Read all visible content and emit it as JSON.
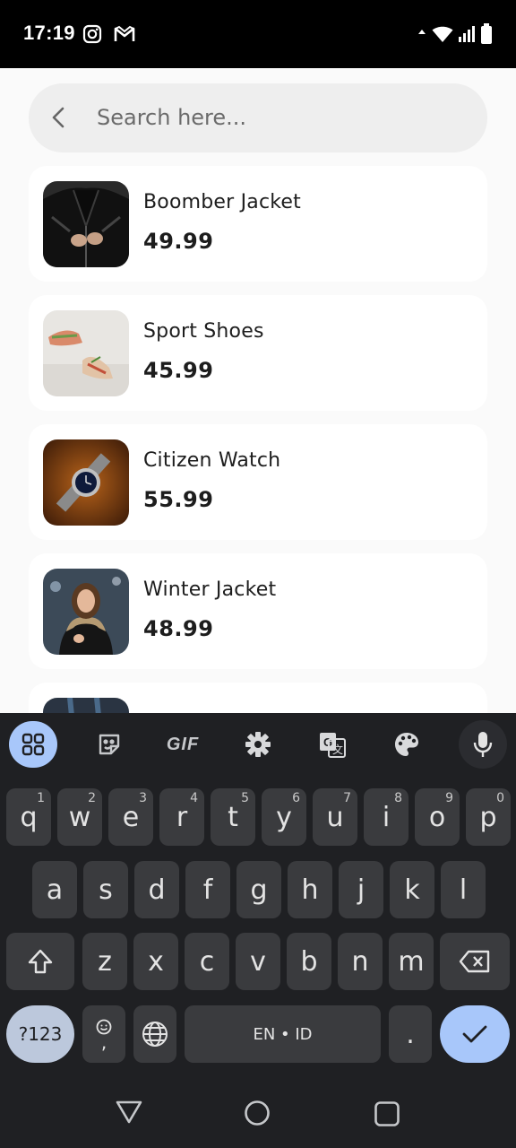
{
  "status": {
    "time": "17:19",
    "icons": [
      "instagram-icon",
      "gmail-icon",
      "data-arrows-icon",
      "wifi-icon",
      "signal-icon",
      "battery-icon"
    ]
  },
  "search": {
    "placeholder": "Search here...",
    "value": ""
  },
  "products": [
    {
      "name": "Boomber Jacket",
      "price": "49.99"
    },
    {
      "name": "Sport Shoes",
      "price": "45.99"
    },
    {
      "name": "Citizen Watch",
      "price": "55.99"
    },
    {
      "name": "Winter Jacket",
      "price": "48.99"
    }
  ],
  "keyboard": {
    "toolbar": {
      "gif_label": "GIF",
      "icons": [
        "apps-grid-icon",
        "sticker-icon",
        "gif-icon",
        "settings-gear-icon",
        "translate-icon",
        "palette-icon",
        "microphone-icon"
      ]
    },
    "row1": [
      {
        "key": "q",
        "hint": "1"
      },
      {
        "key": "w",
        "hint": "2"
      },
      {
        "key": "e",
        "hint": "3"
      },
      {
        "key": "r",
        "hint": "4"
      },
      {
        "key": "t",
        "hint": "5"
      },
      {
        "key": "y",
        "hint": "6"
      },
      {
        "key": "u",
        "hint": "7"
      },
      {
        "key": "i",
        "hint": "8"
      },
      {
        "key": "o",
        "hint": "9"
      },
      {
        "key": "p",
        "hint": "0"
      }
    ],
    "row2": [
      "a",
      "s",
      "d",
      "f",
      "g",
      "h",
      "j",
      "k",
      "l"
    ],
    "row3": [
      "z",
      "x",
      "c",
      "v",
      "b",
      "n",
      "m"
    ],
    "symbols_label": "?123",
    "comma_label": ",",
    "space_label": "EN • ID",
    "period_label": "."
  },
  "colors": {
    "accent_blue": "#a8c7fa",
    "keyboard_bg": "#1f2023",
    "key_bg": "#3a3b3e",
    "app_bg": "#fafafa"
  }
}
